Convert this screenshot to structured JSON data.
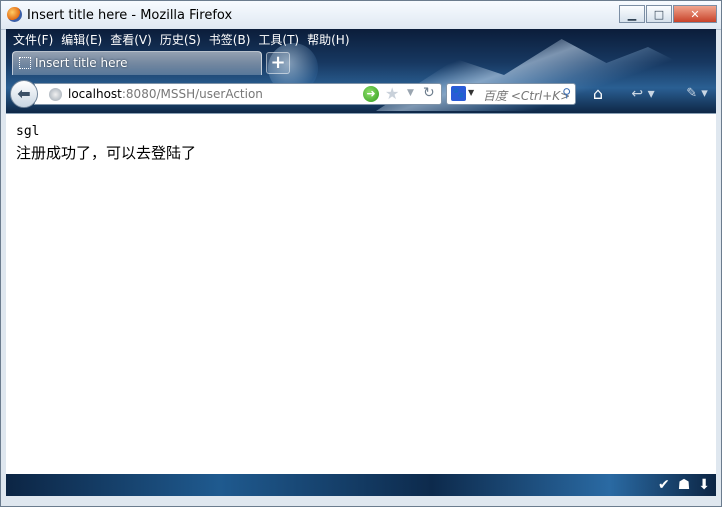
{
  "window": {
    "title": "Insert title here - Mozilla Firefox",
    "controls": {
      "minimize": "▁",
      "maximize": "□",
      "close": "✕"
    }
  },
  "menubar": {
    "items": [
      {
        "label": "文件(F)"
      },
      {
        "label": "编辑(E)"
      },
      {
        "label": "查看(V)"
      },
      {
        "label": "历史(S)"
      },
      {
        "label": "书签(B)"
      },
      {
        "label": "工具(T)"
      },
      {
        "label": "帮助(H)"
      }
    ]
  },
  "tabs": [
    {
      "label": "Insert title here",
      "active": true
    }
  ],
  "newtab_label": "+",
  "navbar": {
    "url_host": "localhost",
    "url_rest": ":8080/MSSH/userAction",
    "search_placeholder": "百度 <Ctrl+K>"
  },
  "page": {
    "line1": "sgl",
    "line2": "注册成功了，可以去登陆了"
  },
  "icons": {
    "back": "back-arrow-icon",
    "site": "globe-icon",
    "go": "go-arrow-icon",
    "bookmark": "star-icon",
    "reload": "reload-icon",
    "search_engine": "baidu-icon",
    "search": "magnifier-icon",
    "home": "home-icon"
  }
}
